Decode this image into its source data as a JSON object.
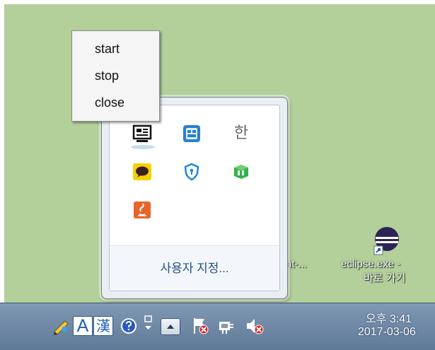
{
  "context_menu": {
    "items": [
      {
        "label": "start"
      },
      {
        "label": "stop"
      },
      {
        "label": "close"
      }
    ]
  },
  "tray_popup": {
    "icons": [
      "server-app-icon",
      "keyboard-app-icon",
      "korean-ime-icon",
      "chat-app-icon",
      "security-shield-icon",
      "green-app-icon",
      "java-app-icon"
    ],
    "hangul_glyph": "한",
    "customize_label": "사용자 지정..."
  },
  "desktop": {
    "icons": [
      {
        "label": "nt-..."
      },
      {
        "label_line1": "eclipse.exe -",
        "label_line2": "바로 가기"
      }
    ]
  },
  "taskbar": {
    "ime_mode": "A",
    "ime_hanja": "漢",
    "clock_time": "오후 3:41",
    "clock_date": "2017-03-06"
  },
  "colors": {
    "desktop": "#b3cf9a",
    "taskbar": "#6d87a6",
    "link_text": "#1f4f86"
  }
}
